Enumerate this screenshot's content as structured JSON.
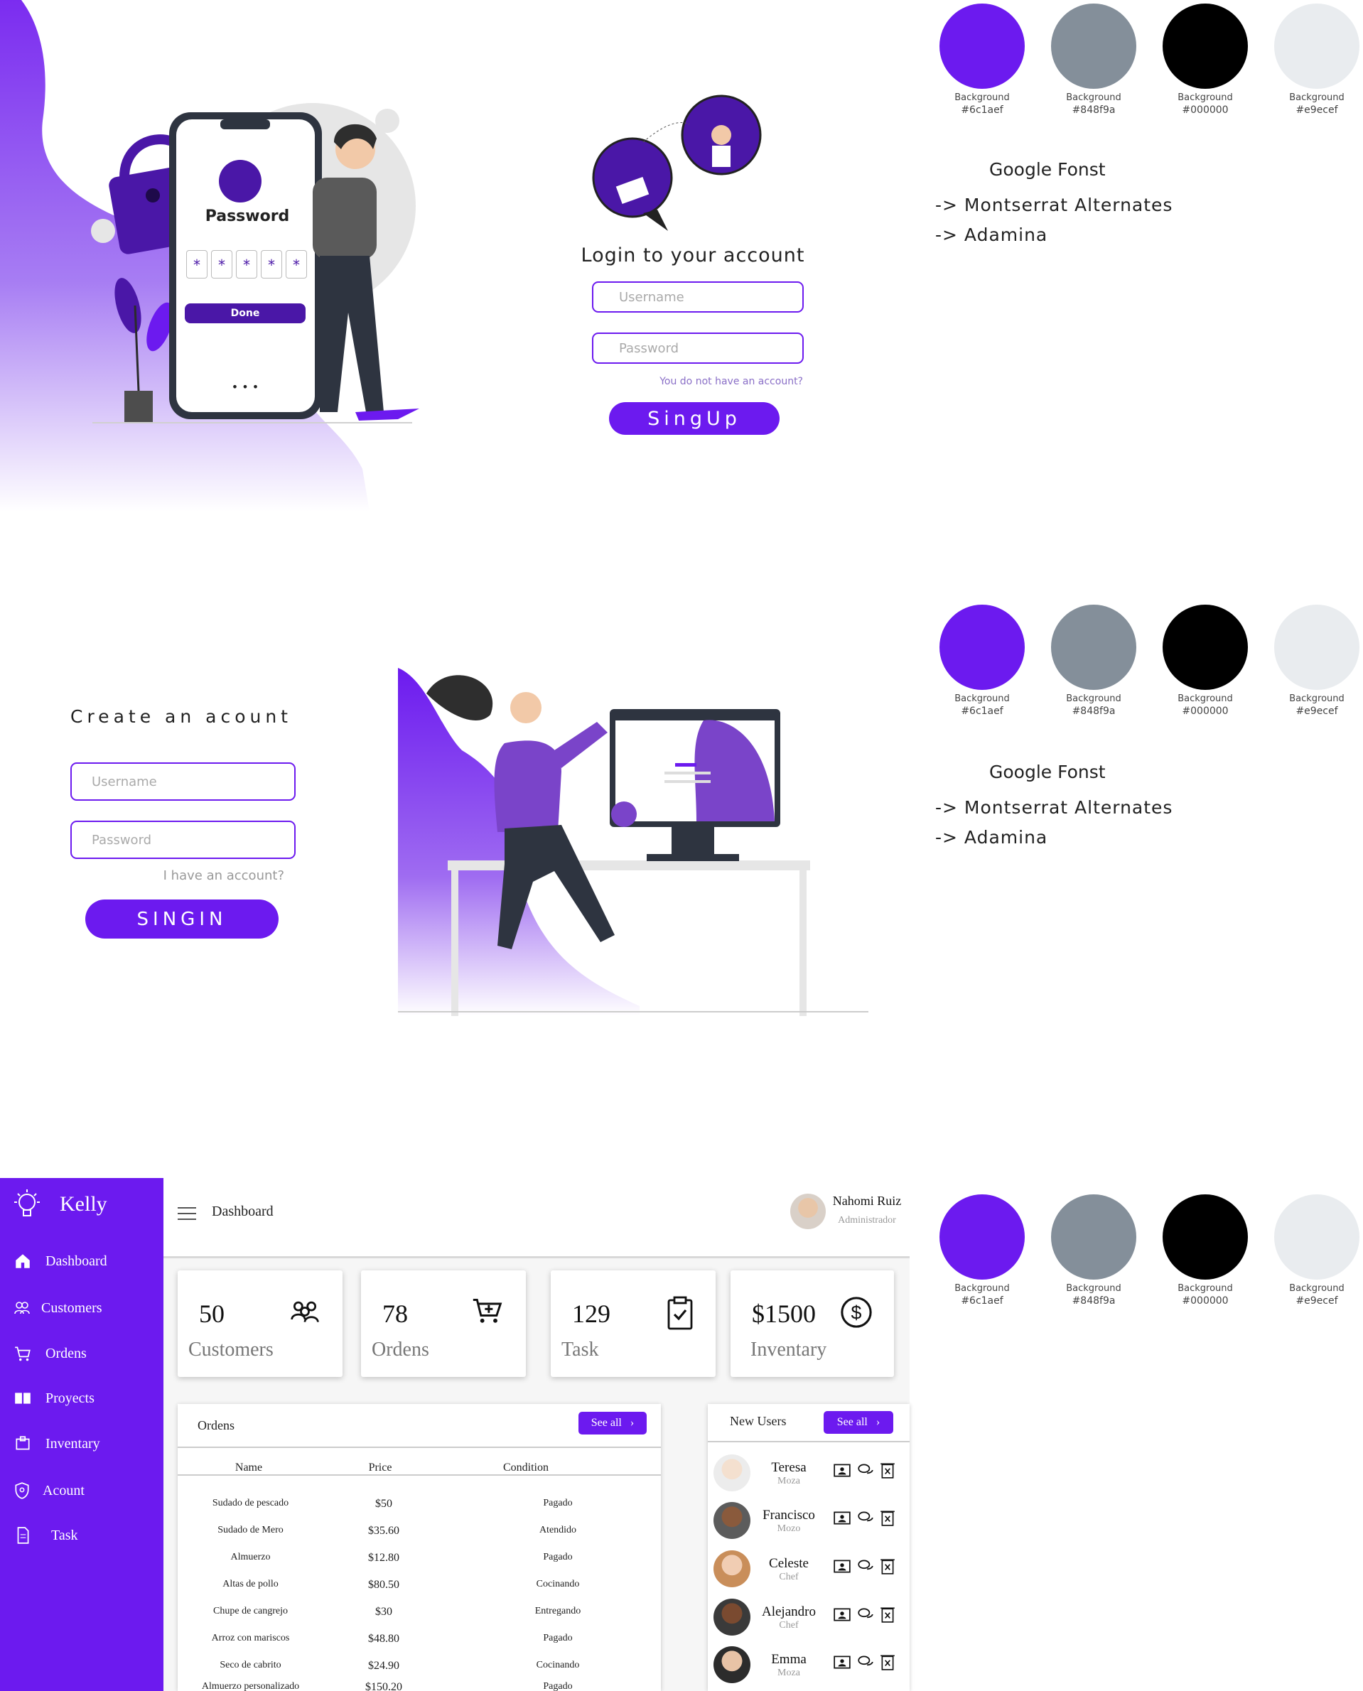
{
  "palette": [
    {
      "label": "Background",
      "hex": "#6c1aef"
    },
    {
      "label": "Background",
      "hex": "#848f9a"
    },
    {
      "label": "Background",
      "hex": "#000000"
    },
    {
      "label": "Background",
      "hex": "#e9ecef"
    }
  ],
  "fonts": {
    "title": "Google Fonst",
    "items": [
      "-> Montserrat Alternates",
      "-> Adamina"
    ]
  },
  "phone": {
    "title": "Password",
    "pin": [
      "*",
      "*",
      "*",
      "*",
      "*"
    ],
    "done": "Done",
    "dots": "• • •"
  },
  "login": {
    "title": "Login to your account",
    "username_placeholder": "Username",
    "password_placeholder": "Password",
    "no_account": "You do not have an account?",
    "button": "SingUp"
  },
  "signup": {
    "title": "Create an acount",
    "username_placeholder": "Username",
    "password_placeholder": "Password",
    "have_account": "I have an account?",
    "button": "SINGIN"
  },
  "dashboard": {
    "brand": "Kelly",
    "header_title": "Dashboard",
    "user": {
      "name": "Nahomi Ruiz",
      "role": "Administrador"
    },
    "sidebar": [
      {
        "label": "Dashboard",
        "icon": "home-icon"
      },
      {
        "label": "Customers",
        "icon": "users-icon"
      },
      {
        "label": "Ordens",
        "icon": "cart-icon"
      },
      {
        "label": "Proyects",
        "icon": "book-icon"
      },
      {
        "label": "Inventary",
        "icon": "box-icon"
      },
      {
        "label": "Acount",
        "icon": "shield-icon"
      },
      {
        "label": "Task",
        "icon": "document-icon"
      }
    ],
    "cards": [
      {
        "value": "50",
        "label": "Customers",
        "icon": "users-icon"
      },
      {
        "value": "78",
        "label": "Ordens",
        "icon": "cart-plus-icon"
      },
      {
        "value": "129",
        "label": "Task",
        "icon": "clipboard-check-icon"
      },
      {
        "value": "$1500",
        "label": "Inventary",
        "icon": "dollar-icon"
      }
    ],
    "orders": {
      "title": "Ordens",
      "see_all": "See all",
      "headers": [
        "Name",
        "Price",
        "Condition"
      ],
      "rows": [
        [
          "Sudado de pescado",
          "$50",
          "Pagado"
        ],
        [
          "Sudado de Mero",
          "$35.60",
          "Atendido"
        ],
        [
          "Almuerzo",
          "$12.80",
          "Pagado"
        ],
        [
          "Altas de pollo",
          "$80.50",
          "Cocinando"
        ],
        [
          "Chupe de cangrejo",
          "$30",
          "Entregando"
        ],
        [
          "Arroz con mariscos",
          "$48.80",
          "Pagado"
        ],
        [
          "Seco de cabrito",
          "$24.90",
          "Cocinando"
        ],
        [
          "Almuerzo personalizado",
          "$150.20",
          "Pagado"
        ]
      ]
    },
    "new_users": {
      "title": "New Users",
      "see_all": "See all",
      "users": [
        {
          "name": "Teresa",
          "role": "Moza"
        },
        {
          "name": "Francisco",
          "role": "Mozo"
        },
        {
          "name": "Celeste",
          "role": "Chef"
        },
        {
          "name": "Alejandro",
          "role": "Chef"
        },
        {
          "name": "Emma",
          "role": "Moza"
        }
      ]
    }
  }
}
